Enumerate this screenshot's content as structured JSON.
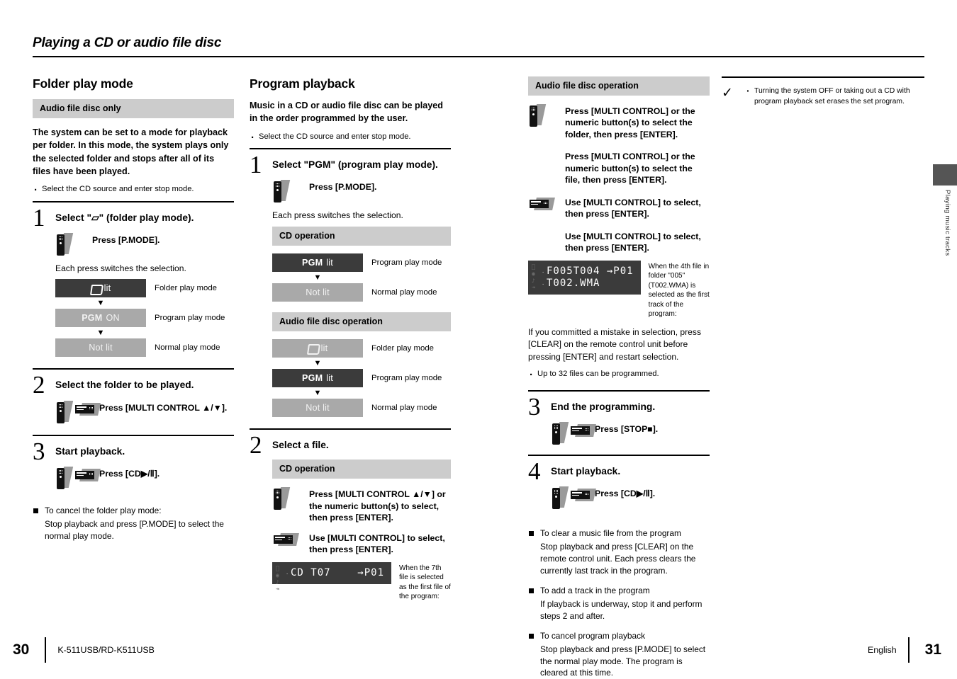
{
  "running_head": {
    "title": "Playing a CD or audio file disc"
  },
  "side_tab": {
    "label": "Playing music tracks"
  },
  "col1": {
    "heading": "Folder play mode",
    "graybar": "Audio file disc only",
    "intro": "The system can be set to a mode for playback per folder. In this mode, the system plays only the selected folder and stops after all of its files have been played.",
    "intro_bullet": "Select the CD source and enter stop mode.",
    "step1": {
      "num": "1",
      "head": "Select \"▱\" (folder play mode).",
      "press": "Press [P.MODE].",
      "note": "Each press switches the selection.",
      "modes": [
        {
          "box": "lit",
          "glyph": "folder",
          "label": "Folder play mode",
          "state": "dark"
        },
        {
          "box": "ON",
          "glyph": "pgm",
          "label": "Program play mode",
          "state": "gray"
        },
        {
          "box": "Not lit",
          "glyph": "none",
          "label": "Normal play mode",
          "state": "gray"
        }
      ]
    },
    "step2": {
      "num": "2",
      "head": "Select the folder to be played.",
      "press": "Press [MULTI CONTROL ▲/▼]."
    },
    "step3": {
      "num": "3",
      "head": "Start playback.",
      "press": "Press [CD▶/Ⅱ]."
    },
    "cancel_title": "To cancel the folder play mode:",
    "cancel_body": "Stop playback and press [P.MODE] to select the normal play mode."
  },
  "col2": {
    "heading": "Program playback",
    "intro": "Music in a CD or audio file disc can be played in the order programmed by the user.",
    "intro_bullet": "Select the CD source and enter stop mode.",
    "step1": {
      "num": "1",
      "head": "Select \"PGM\" (program play mode).",
      "press": "Press [P.MODE].",
      "note": "Each press switches the selection.",
      "cd_bar": "CD operation",
      "cd_modes": [
        {
          "box": "lit",
          "glyph": "pgm",
          "label": "Program play mode",
          "state": "dark"
        },
        {
          "box": "Not lit",
          "glyph": "none",
          "label": "Normal play mode",
          "state": "gray"
        }
      ],
      "afd_bar": "Audio file disc operation",
      "afd_modes": [
        {
          "box": "lit",
          "glyph": "folder",
          "label": "Folder play mode",
          "state": "gray"
        },
        {
          "box": "lit",
          "glyph": "pgm",
          "label": "Program play mode",
          "state": "dark"
        },
        {
          "box": "Not lit",
          "glyph": "none",
          "label": "Normal play mode",
          "state": "gray"
        }
      ]
    },
    "step2": {
      "num": "2",
      "head": "Select a file.",
      "cd_bar": "CD operation",
      "remote_text": "Press [MULTI CONTROL ▲/▼] or the numeric button(s) to select, then press [ENTER].",
      "unit_text": "Use [MULTI CONTROL] to select, then press [ENTER].",
      "lcd_line1": "CD T07    →P01",
      "lcd_note": "When the 7th file is selected as the first file of the program:"
    }
  },
  "col3": {
    "afd_bar": "Audio file disc operation",
    "remote_text1": "Press [MULTI CONTROL] or the numeric button(s) to select the folder, then press [ENTER].",
    "remote_text2": "Press [MULTI CONTROL] or the numeric button(s) to select the file, then press [ENTER].",
    "unit_text1": "Use [MULTI CONTROL] to select, then press [ENTER].",
    "unit_text2": "Use [MULTI CONTROL] to select, then press [ENTER].",
    "lcd_line1": "F005T004 →P01",
    "lcd_line2": "T002.WMA",
    "lcd_note": "When the 4th file in folder \"005\" (T002.WMA) is selected as the first track of the program:",
    "mistake_para": "If you committed a mistake in selection, press [CLEAR] on the remote control unit before pressing [ENTER] and restart selection.",
    "limit_bullet": "Up to 32 files can be programmed.",
    "step3": {
      "num": "3",
      "head": "End the programming.",
      "press": "Press [STOP■]."
    },
    "step4": {
      "num": "4",
      "head": "Start playback.",
      "press": "Press [CD▶/Ⅱ]."
    },
    "notes": [
      {
        "title": "To clear a music file from the program",
        "body": "Stop playback and press [CLEAR] on the remote control unit. Each press clears the currently last track in the program."
      },
      {
        "title": "To add a track in the program",
        "body": "If playback is underway, stop it and perform steps 2 and after."
      },
      {
        "title": "To cancel program playback",
        "body": "Stop playback and press [P.MODE] to select the normal play mode. The program is cleared at this time."
      }
    ]
  },
  "col4": {
    "note": "Turning the system OFF or taking out a CD with program playback set erases the set program."
  },
  "footer": {
    "left_page": "30",
    "model": "K-511USB/RD-K511USB",
    "language": "English",
    "right_page": "31"
  },
  "colors": {
    "gray_bar": "#cccccc",
    "mode_dark": "#3b3b3b",
    "mode_gray": "#a9a9a9",
    "lcd_bg": "#3b3b3b",
    "side_tab": "#555555"
  }
}
